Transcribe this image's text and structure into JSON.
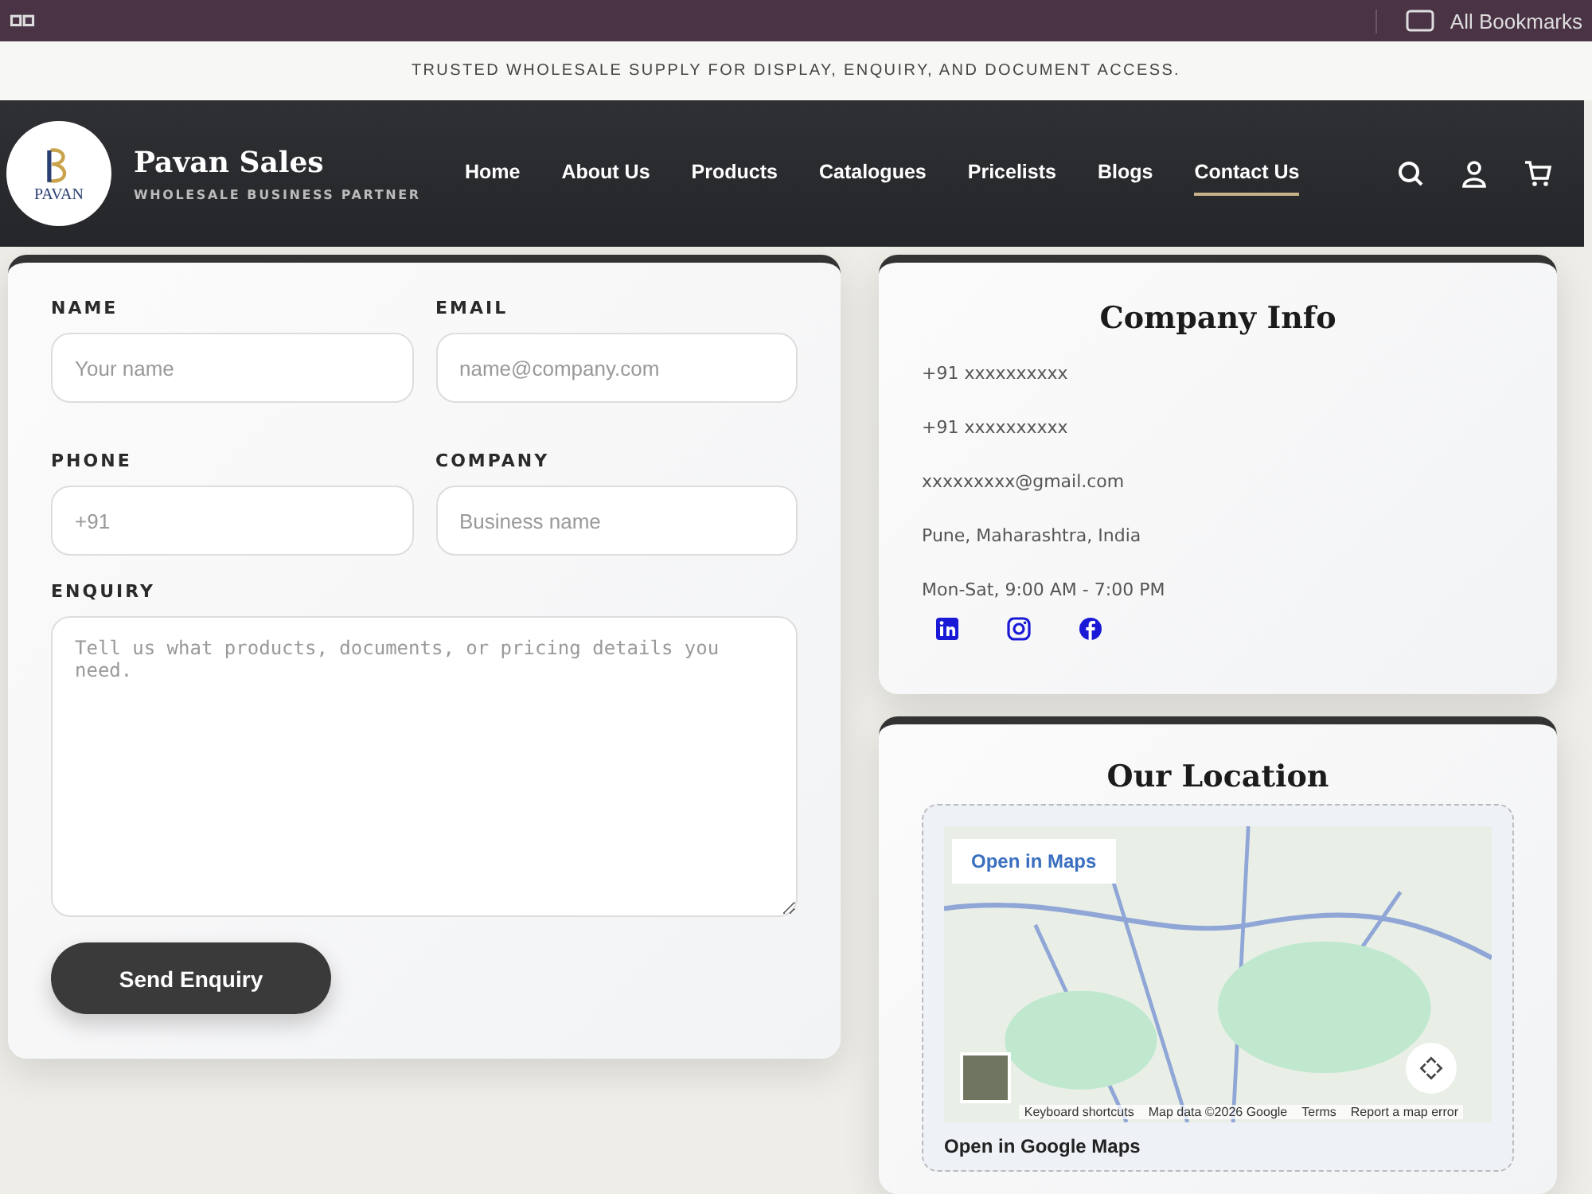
{
  "browser_bar": {
    "bookmarks_label": "All Bookmarks"
  },
  "announcement": "TRUSTED WHOLESALE SUPPLY FOR DISPLAY, ENQUIRY, AND DOCUMENT ACCESS.",
  "header": {
    "logo_text": "PAVAN",
    "brand": "Pavan Sales",
    "tagline": "WHOLESALE BUSINESS PARTNER",
    "nav": [
      {
        "label": "Home",
        "selected": false
      },
      {
        "label": "About Us",
        "selected": false
      },
      {
        "label": "Products",
        "selected": false
      },
      {
        "label": "Catalogues",
        "selected": false
      },
      {
        "label": "Pricelists",
        "selected": false
      },
      {
        "label": "Blogs",
        "selected": false
      },
      {
        "label": "Contact Us",
        "selected": true
      }
    ],
    "actions": [
      {
        "kind": "search"
      },
      {
        "kind": "account"
      },
      {
        "kind": "cart"
      }
    ]
  },
  "form": {
    "fields": [
      {
        "label": "NAME",
        "placeholder": "Your name",
        "kind": "input"
      },
      {
        "label": "EMAIL",
        "placeholder": "name@company.com",
        "kind": "input"
      },
      {
        "label": "PHONE",
        "placeholder": "+91",
        "kind": "input"
      },
      {
        "label": "COMPANY",
        "placeholder": "Business name",
        "kind": "input"
      },
      {
        "label": "ENQUIRY",
        "placeholder": "Tell us what products, documents, or pricing details you need.",
        "kind": "textarea"
      }
    ],
    "submit": "Send Enquiry"
  },
  "company_info": {
    "title": "Company Info",
    "lines": [
      "+91 xxxxxxxxxx",
      "+91 xxxxxxxxxx",
      "xxxxxxxxx@gmail.com",
      "Pune, Maharashtra, India",
      "Mon-Sat, 9:00 AM - 7:00 PM"
    ],
    "social": [
      {
        "kind": "linkedin"
      },
      {
        "kind": "instagram"
      },
      {
        "kind": "facebook"
      }
    ]
  },
  "location": {
    "title": "Our Location",
    "open_in_maps": "Open in Maps",
    "map_footer": [
      "Keyboard shortcuts",
      "Map data ©2026 Google",
      "Terms",
      "Report a map error"
    ],
    "link": "Open in Google Maps"
  }
}
